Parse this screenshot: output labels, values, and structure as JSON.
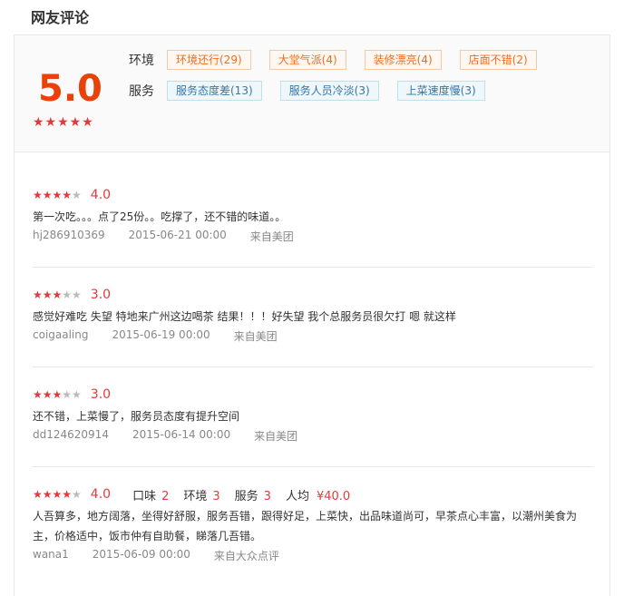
{
  "title": "网友评论",
  "summary": {
    "score": "5.0",
    "stars": "★★★★★",
    "env_label": "环境",
    "service_label": "服务",
    "env_tags": [
      "环境还行(29)",
      "大堂气派(4)",
      "装修漂亮(4)",
      "店面不错(2)"
    ],
    "service_tags": [
      "服务态度差(13)",
      "服务人员冷淡(3)",
      "上菜速度慢(3)"
    ]
  },
  "reviews": [
    {
      "stars_on": "★★★★",
      "stars_off": "★",
      "rating": "4.0",
      "content": "第一次吃。。。点了25份。。吃撑了，还不错的味道。。",
      "user": "hj286910369",
      "date": "2015-06-21 00:00",
      "source": "来自美团"
    },
    {
      "stars_on": "★★★",
      "stars_off": "★★",
      "rating": "3.0",
      "content": "感觉好难吃 失望 特地来广州这边喝茶 结果！！！好失望 我个总服务员很欠打 嗯 就这样",
      "user": "coigaaling",
      "date": "2015-06-19 00:00",
      "source": "来自美团"
    },
    {
      "stars_on": "★★★",
      "stars_off": "★★",
      "rating": "3.0",
      "content": "还不错，上菜慢了，服务员态度有提升空间",
      "user": "dd124620914",
      "date": "2015-06-14 00:00",
      "source": "来自美团"
    },
    {
      "stars_on": "★★★★",
      "stars_off": "★",
      "rating": "4.0",
      "taste_label": "口味",
      "taste": "2",
      "env_label": "环境",
      "env": "3",
      "service_label": "服务",
      "service": "3",
      "avg_label": "人均",
      "avg": "¥40.0",
      "content": "人吾算多，地方阔落，坐得好舒服，服务吾错，跟得好足，上菜快，出品味道尚可，早茶点心丰富，以潮州美食为主，价格适中，饭市仲有自助餐，睇落几吾错。",
      "user": "wana1",
      "date": "2015-06-09 00:00",
      "source": "来自大众点评"
    }
  ]
}
